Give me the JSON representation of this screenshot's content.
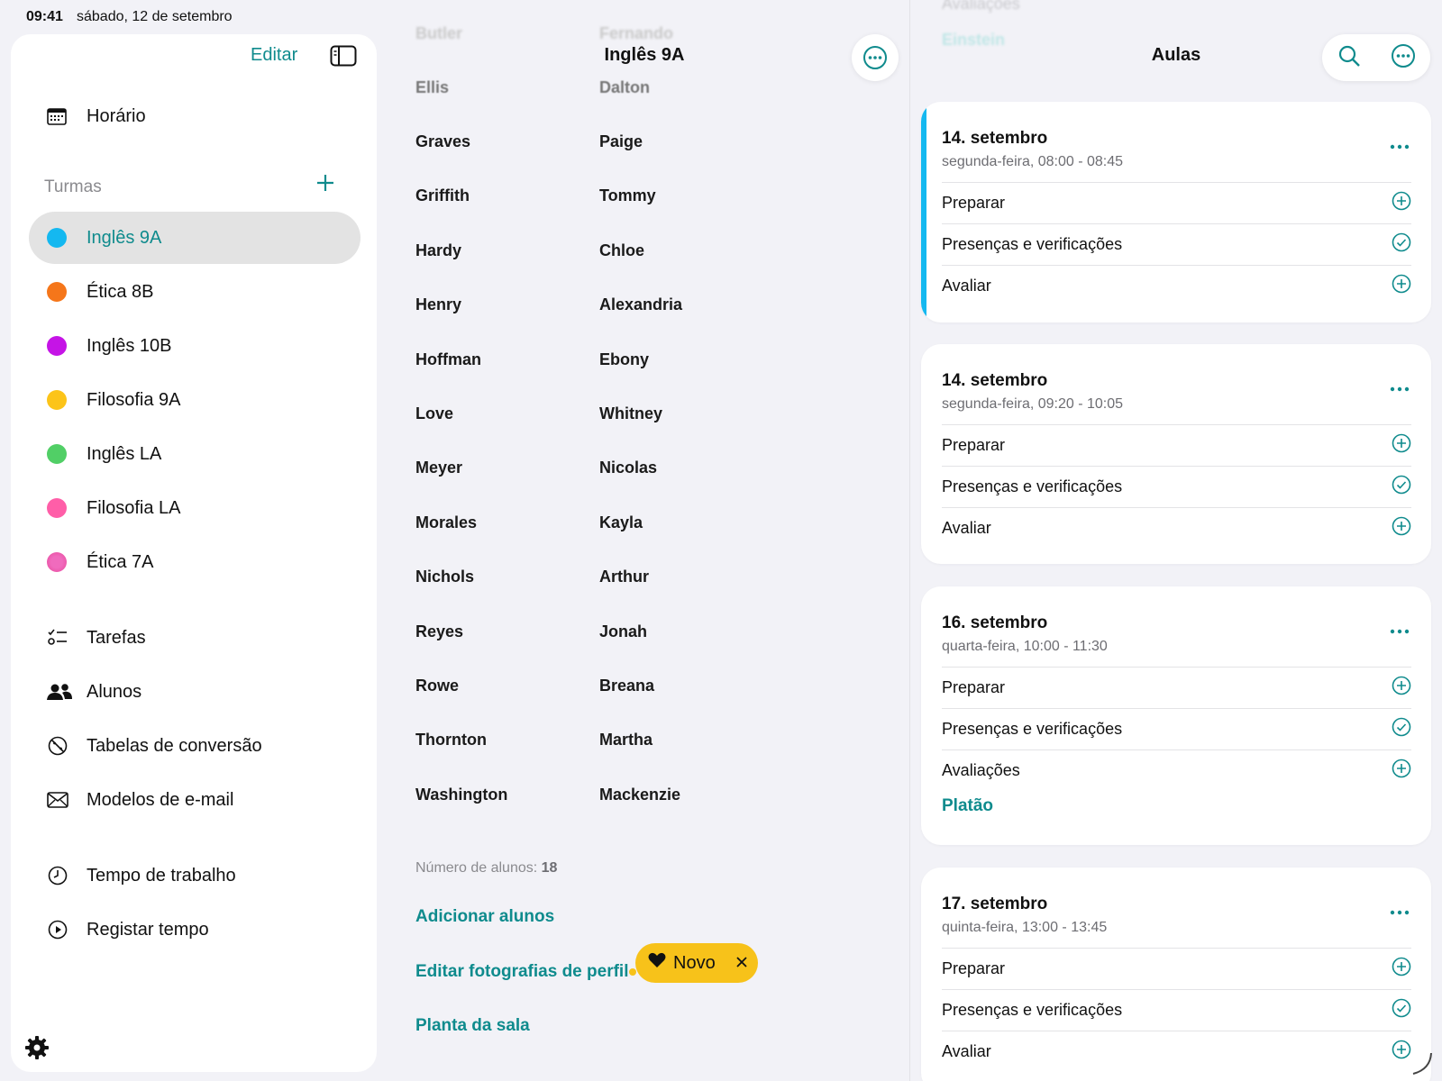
{
  "status": {
    "time": "09:41",
    "date": "sábado, 12 de setembro"
  },
  "sidebar": {
    "edit_label": "Editar",
    "nav_top": {
      "label": "Horário",
      "icon": "calendar-icon"
    },
    "section_label": "Turmas",
    "classes": [
      {
        "label": "Inglês 9A",
        "color": "#14b8f0",
        "active": true
      },
      {
        "label": "Ética 8B",
        "color": "#f5761a"
      },
      {
        "label": "Inglês 10B",
        "color": "#c514e6"
      },
      {
        "label": "Filosofia 9A",
        "color": "#fcc419"
      },
      {
        "label": "Inglês LA",
        "color": "#51cf66"
      },
      {
        "label": "Filosofia LA",
        "color": "#ff5ea8"
      },
      {
        "label": "Ética 7A",
        "color": "#f06bbd"
      }
    ],
    "tools": [
      {
        "label": "Tarefas",
        "icon": "checklist-icon"
      },
      {
        "label": "Alunos",
        "icon": "people-icon"
      },
      {
        "label": "Tabelas de conversão",
        "icon": "no-percent-icon"
      },
      {
        "label": "Modelos de e-mail",
        "icon": "envelope-icon"
      }
    ],
    "time_tools": [
      {
        "label": "Tempo de trabalho",
        "icon": "clock-icon"
      },
      {
        "label": "Registar tempo",
        "icon": "play-circle-icon"
      }
    ]
  },
  "middle": {
    "title": "Inglês 9A",
    "faded_top": [
      [
        "Butler",
        "Fernando"
      ]
    ],
    "faded_second": [
      [
        "Ellis",
        "Dalton"
      ]
    ],
    "students": [
      [
        "Graves",
        "Paige"
      ],
      [
        "Griffith",
        "Tommy"
      ],
      [
        "Hardy",
        "Chloe"
      ],
      [
        "Henry",
        "Alexandria"
      ],
      [
        "Hoffman",
        "Ebony"
      ],
      [
        "Love",
        "Whitney"
      ],
      [
        "Meyer",
        "Nicolas"
      ],
      [
        "Morales",
        "Kayla"
      ],
      [
        "Nichols",
        "Arthur"
      ],
      [
        "Reyes",
        "Jonah"
      ],
      [
        "Rowe",
        "Breana"
      ],
      [
        "Thornton",
        "Martha"
      ],
      [
        "Washington",
        "Mackenzie"
      ]
    ],
    "count_label": "Número de alunos:",
    "count_value": "18",
    "links": [
      "Adicionar alunos",
      "Editar fotografias de perfil",
      "Planta da sala"
    ],
    "badge": {
      "label": "Novo"
    }
  },
  "right": {
    "title": "Aulas",
    "faded_top": [
      "Avaliações",
      "Einstein"
    ],
    "lessons": [
      {
        "title": "14. setembro",
        "subtitle": "segunda-feira, 08:00 - 08:45",
        "rows": [
          {
            "label": "Preparar",
            "icon": "plus-circle-icon"
          },
          {
            "label": "Presenças e verificações",
            "icon": "check-circle-icon"
          },
          {
            "label": "Avaliar",
            "icon": "plus-circle-icon"
          }
        ],
        "accent": true
      },
      {
        "title": "14. setembro",
        "subtitle": "segunda-feira, 09:20 - 10:05",
        "rows": [
          {
            "label": "Preparar",
            "icon": "plus-circle-icon"
          },
          {
            "label": "Presenças e verificações",
            "icon": "check-circle-icon"
          },
          {
            "label": "Avaliar",
            "icon": "plus-circle-icon"
          }
        ]
      },
      {
        "title": "16. setembro",
        "subtitle": "quarta-feira, 10:00 - 11:30",
        "rows": [
          {
            "label": "Preparar",
            "icon": "plus-circle-icon"
          },
          {
            "label": "Presenças e verificações",
            "icon": "check-circle-icon"
          },
          {
            "label": "Avaliações",
            "icon": "plus-circle-icon"
          }
        ],
        "link": "Platão"
      },
      {
        "title": "17. setembro",
        "subtitle": "quinta-feira, 13:00 - 13:45",
        "rows": [
          {
            "label": "Preparar",
            "icon": "plus-circle-icon"
          },
          {
            "label": "Presenças e verificações",
            "icon": "check-circle-icon"
          },
          {
            "label": "Avaliar",
            "icon": "plus-circle-icon"
          }
        ]
      }
    ]
  },
  "colors": {
    "accent": "#0f8b8d",
    "badge": "#f7c21a"
  }
}
